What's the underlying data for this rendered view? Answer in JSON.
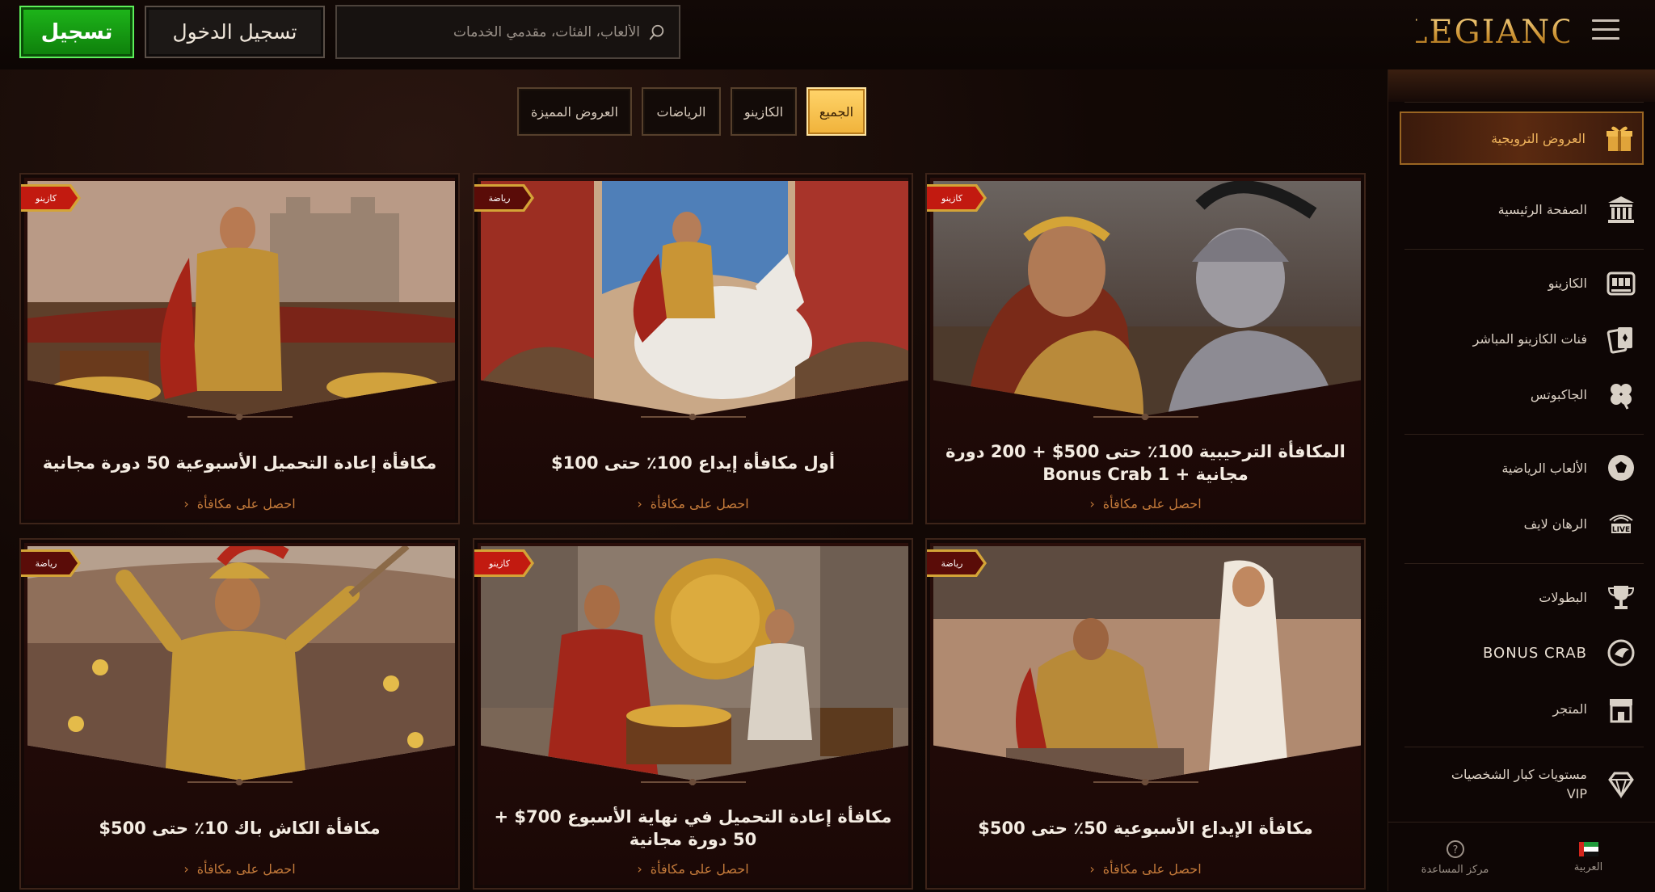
{
  "header": {
    "register_label": "تسجيل",
    "login_label": "تسجيل الدخول",
    "search_placeholder": "الألعاب، الفئات، مقدمي الخدمات",
    "logo_text": "LEGIANO"
  },
  "filters": {
    "tabs": [
      {
        "label": "الجميع",
        "active": true
      },
      {
        "label": "الكازينو",
        "active": false
      },
      {
        "label": "الرياضات",
        "active": false
      },
      {
        "label": "العروض المميزة",
        "active": false
      }
    ]
  },
  "promotions": [
    {
      "badge": "كازينو",
      "title": "المكافأة الترحيبية 100٪ حتى 500$ + 200 دورة مجانية + Bonus Crab 1",
      "link": "احصل على مكافأة",
      "scene": "helmets"
    },
    {
      "badge": "رياضة",
      "title": "أول مكافأة إيداع 100٪ حتى 100$",
      "link": "احصل على مكافأة",
      "scene": "horse"
    },
    {
      "badge": "كازينو",
      "title": "مكافأة إعادة التحميل الأسبوعية 50 دورة مجانية",
      "link": "احصل على مكافأة",
      "scene": "general"
    },
    {
      "badge": "رياضة",
      "title": "مكافأة الإيداع الأسبوعية 50٪ حتى 500$",
      "link": "احصل على مكافأة",
      "scene": "crowning"
    },
    {
      "badge": "كازينو",
      "title": "مكافأة إعادة التحميل في نهاية الأسبوع 700$ + 50 دورة مجانية",
      "link": "احصل على مكافأة",
      "scene": "shield"
    },
    {
      "badge": "رياضة",
      "title": "مكافأة الكاش باك 10٪ حتى 500$",
      "link": "احصل على مكافأة",
      "scene": "warrior"
    }
  ],
  "sidebar": {
    "items": [
      {
        "label": "العروض الترويجية",
        "icon": "gift-icon",
        "active": true
      },
      {
        "label": "الصفحة الرئيسية",
        "icon": "temple-icon",
        "active": false
      },
      {
        "label": "الكازينو",
        "icon": "slot-machine-icon",
        "active": false
      },
      {
        "label": "فنات الكازينو المباشر",
        "icon": "cards-icon",
        "active": false
      },
      {
        "label": "الجاكبوتس",
        "icon": "clover-icon",
        "active": false
      },
      {
        "label": "الألعاب الرياضية",
        "icon": "soccer-ball-icon",
        "active": false
      },
      {
        "label": "الرهان لايف",
        "icon": "live-icon",
        "active": false
      },
      {
        "label": "البطولات",
        "icon": "trophy-icon",
        "active": false
      },
      {
        "label": "BONUS CRAB",
        "icon": "crab-icon",
        "active": false
      },
      {
        "label": "المتجر",
        "icon": "shop-icon",
        "active": false
      },
      {
        "label": "مستويات كبار الشخصيات VIP",
        "icon": "diamond-icon",
        "active": false
      }
    ],
    "footer": {
      "help_label": "مركز المساعدة",
      "language_label": "العربية"
    }
  },
  "colors": {
    "accent_gold": "#f0b23a",
    "register_green": "#14a011",
    "card_red": "#2a0e0a",
    "badge_red": "#c21a10"
  }
}
